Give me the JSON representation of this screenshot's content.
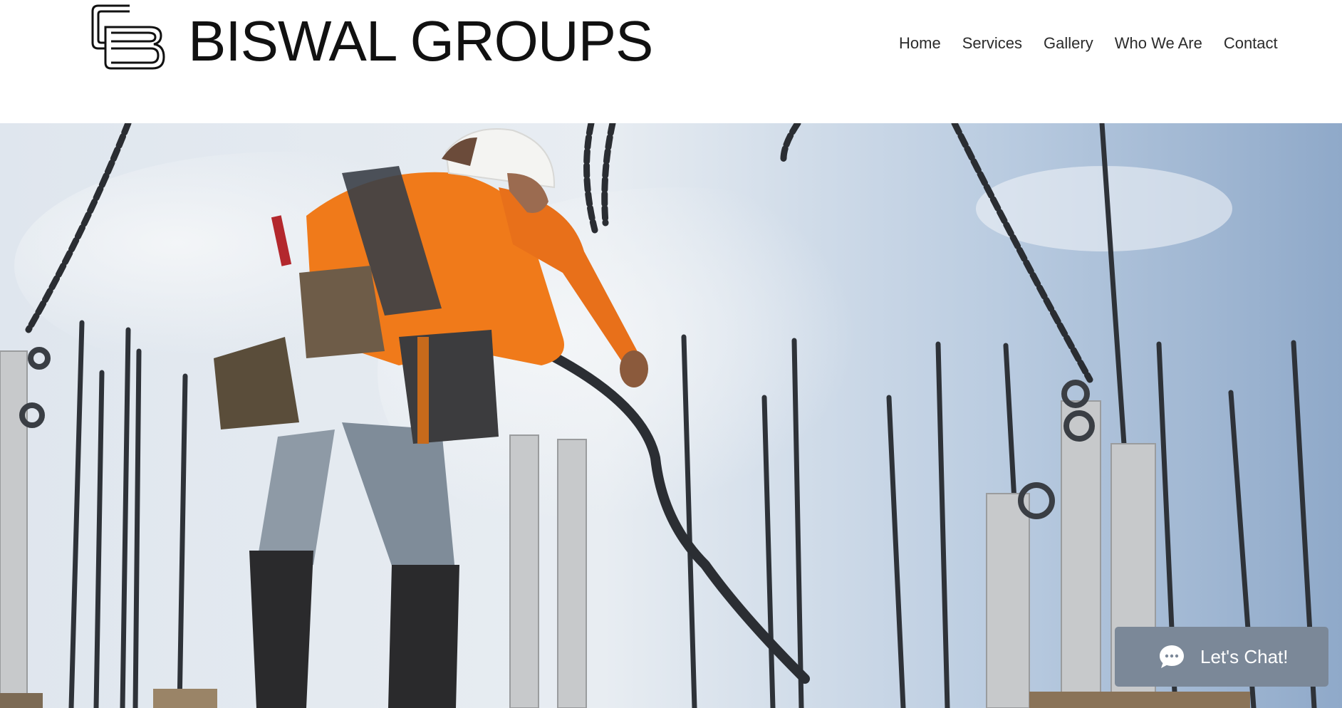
{
  "header": {
    "brand_name": "BISWAL GROUPS",
    "logo_icon": "bg-monogram-logo-icon"
  },
  "nav": {
    "items": [
      {
        "label": "Home"
      },
      {
        "label": "Services"
      },
      {
        "label": "Gallery"
      },
      {
        "label": "Who We Are"
      },
      {
        "label": "Contact"
      }
    ]
  },
  "hero": {
    "image_icon": "construction-worker-photo"
  },
  "chat": {
    "label": "Let's Chat!",
    "icon": "chat-bubble-icon"
  },
  "colors": {
    "text": "#111111",
    "nav_text": "#2b2b2b",
    "chat_bg": "#7b8898",
    "sky": "#c8d6e6",
    "worker_shirt": "#f07a1a"
  }
}
